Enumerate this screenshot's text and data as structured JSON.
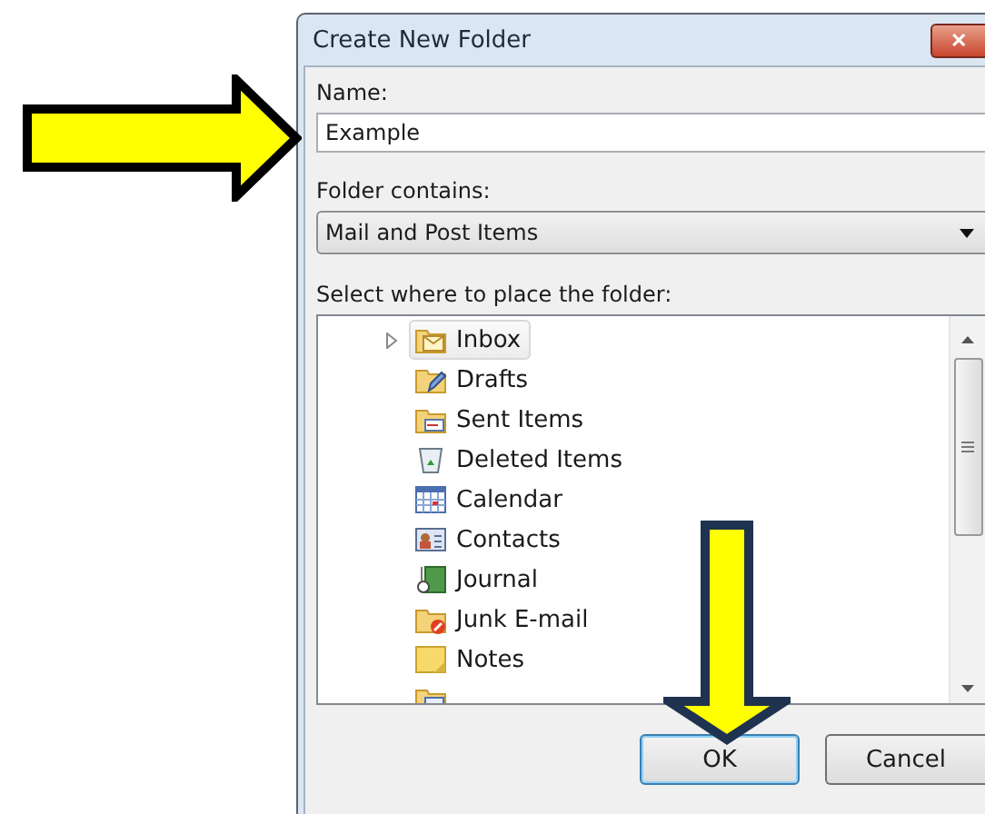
{
  "window": {
    "title": "Create New Folder",
    "close": "✕"
  },
  "name_field": {
    "label": "Name:",
    "value": "Example"
  },
  "contents_dropdown": {
    "label": "Folder contains:",
    "value": "Mail and Post Items"
  },
  "tree": {
    "label": "Select where to place the folder:",
    "items": [
      {
        "label": "Inbox",
        "kind": "inbox",
        "selected": true,
        "expandable": true
      },
      {
        "label": "Drafts",
        "kind": "drafts",
        "selected": false,
        "expandable": false
      },
      {
        "label": "Sent Items",
        "kind": "sent",
        "selected": false,
        "expandable": false
      },
      {
        "label": "Deleted Items",
        "kind": "trash",
        "selected": false,
        "expandable": false
      },
      {
        "label": "Calendar",
        "kind": "calendar",
        "selected": false,
        "expandable": false
      },
      {
        "label": "Contacts",
        "kind": "contacts",
        "selected": false,
        "expandable": false
      },
      {
        "label": "Journal",
        "kind": "journal",
        "selected": false,
        "expandable": false
      },
      {
        "label": "Junk E-mail",
        "kind": "junk",
        "selected": false,
        "expandable": false
      },
      {
        "label": "Notes",
        "kind": "notes",
        "selected": false,
        "expandable": false
      },
      {
        "kind": "outbox",
        "selected": false,
        "expandable": false
      }
    ]
  },
  "buttons": [
    {
      "label": "OK",
      "default": true
    },
    {
      "label": "Cancel",
      "default": false
    }
  ]
}
